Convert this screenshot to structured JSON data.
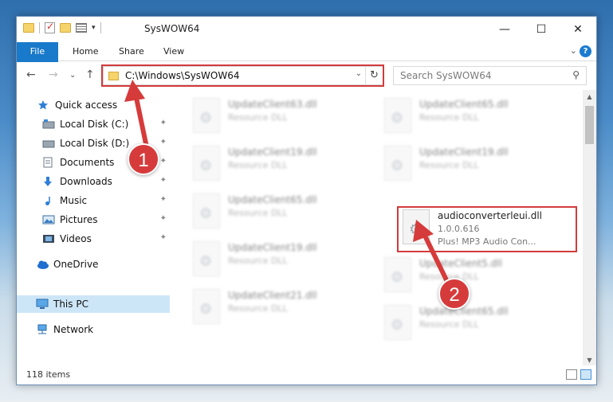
{
  "window": {
    "title": "SysWOW64",
    "controls": {
      "minimize": "—",
      "maximize": "☐",
      "close": "✕"
    }
  },
  "ribbon": {
    "tabs": [
      "File",
      "Home",
      "Share",
      "View"
    ],
    "expand_glyph": "⌄",
    "help_glyph": "?"
  },
  "address": {
    "path": "C:\\Windows\\SysWOW64",
    "nav": {
      "back": "←",
      "forward": "→",
      "recent": "⌄",
      "up": "↑"
    },
    "dropdown_glyph": "⌄",
    "refresh_glyph": "↻"
  },
  "search": {
    "placeholder": "Search SysWOW64",
    "icon": "search-icon",
    "glyph": "⚲"
  },
  "sidebar": {
    "items": [
      {
        "label": "Quick access",
        "icon": "star-icon"
      },
      {
        "label": "Local Disk (C:)",
        "icon": "drive-icon",
        "pinned": true
      },
      {
        "label": "Local Disk (D:)",
        "icon": "drive-icon",
        "pinned": true
      },
      {
        "label": "Documents",
        "icon": "document-icon",
        "pinned": true
      },
      {
        "label": "Downloads",
        "icon": "download-icon",
        "pinned": true
      },
      {
        "label": "Music",
        "icon": "music-icon",
        "pinned": true
      },
      {
        "label": "Pictures",
        "icon": "pictures-icon",
        "pinned": true
      },
      {
        "label": "Videos",
        "icon": "videos-icon",
        "pinned": true
      },
      {
        "label": "OneDrive",
        "icon": "cloud-icon"
      },
      {
        "label": "This PC",
        "icon": "computer-icon",
        "selected": true
      },
      {
        "label": "Network",
        "icon": "network-icon"
      }
    ],
    "pin_glyph": "📌"
  },
  "files": [
    {
      "name": "UpdateClient63.dll",
      "type": "Resource DLL"
    },
    {
      "name": "UpdateClient65.dll",
      "type": "Resource DLL"
    },
    {
      "name": "UpdateClient19.dll",
      "type": "Resource DLL"
    },
    {
      "name": "UpdateClient19.dll",
      "type": "Resource DLL"
    },
    {
      "name": "UpdateClient65.dll",
      "type": "Resource DLL"
    },
    {
      "name": "audioconverterleui.dll",
      "version": "1.0.0.616",
      "type": "Plus! MP3 Audio Con...",
      "highlighted": true
    },
    {
      "name": "UpdateClient19.dll",
      "type": "Resource DLL"
    },
    {
      "name": "UpdateClient5.dll",
      "type": "Resource DLL"
    },
    {
      "name": "UpdateClient21.dll",
      "type": "Resource DLL"
    },
    {
      "name": "UpdateClient65.dll",
      "type": "Resource DLL"
    }
  ],
  "status": {
    "item_count": "118 items"
  },
  "callouts": [
    "1",
    "2"
  ],
  "colors": {
    "accent": "#1979ca",
    "highlight": "#d33b3b",
    "selected": "#cde6f7"
  }
}
